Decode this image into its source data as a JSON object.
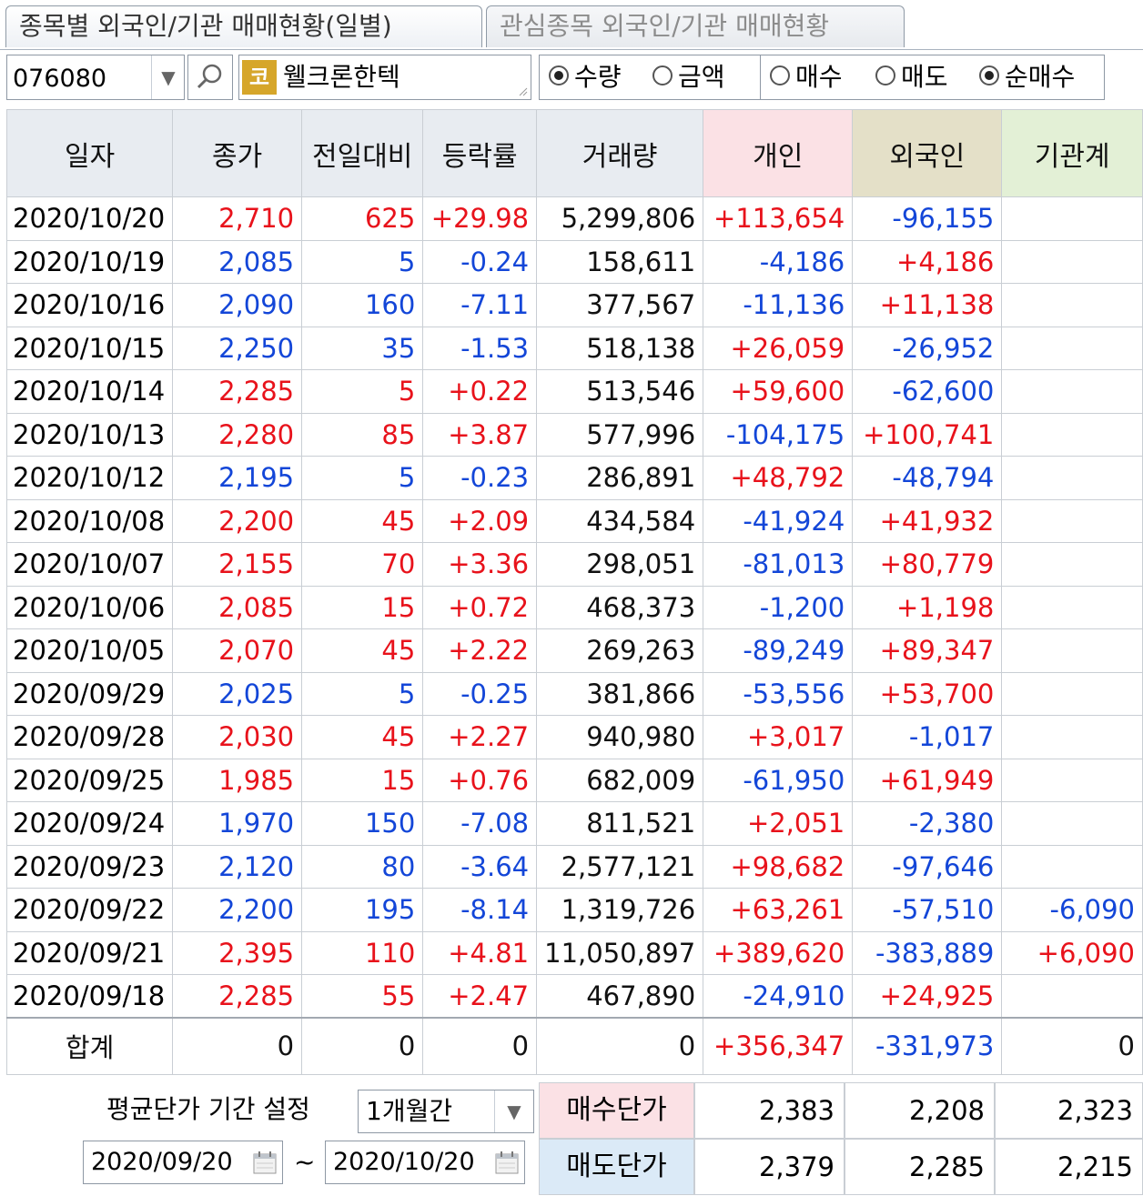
{
  "tabs": [
    {
      "label": "종목별 외국인/기관 매매현황(일별)",
      "active": true
    },
    {
      "label": "관심종목 외국인/기관 매매현황",
      "active": false
    }
  ],
  "toolbar": {
    "stock_code": "076080",
    "market_badge": "코",
    "stock_name": "웰크론한텍",
    "unit_options": [
      {
        "label": "수량",
        "selected": true
      },
      {
        "label": "금액",
        "selected": false
      }
    ],
    "type_options": [
      {
        "label": "매수",
        "selected": false
      },
      {
        "label": "매도",
        "selected": false
      },
      {
        "label": "순매수",
        "selected": true
      }
    ]
  },
  "colors": {
    "up": "#e8121b",
    "down": "#1346d8",
    "indiv_header": "#fbe1e5",
    "foreign_header": "#e4e0c8",
    "inst_header": "#e3f0d6",
    "sell_price_bg": "#dbeaf7",
    "buy_price_bg": "#fbe1e5"
  },
  "table": {
    "headers": [
      "일자",
      "종가",
      "전일대비",
      "등락률",
      "거래량",
      "개인",
      "외국인",
      "기관계"
    ],
    "rows": [
      {
        "date": "2020/10/20",
        "close": "2,710",
        "change": "625",
        "rate": "+29.98",
        "volume": "5,299,806",
        "indiv": "+113,654",
        "foreign": "-96,155",
        "inst": "",
        "dir": "up"
      },
      {
        "date": "2020/10/19",
        "close": "2,085",
        "change": "5",
        "rate": "-0.24",
        "volume": "158,611",
        "indiv": "-4,186",
        "foreign": "+4,186",
        "inst": "",
        "dir": "down"
      },
      {
        "date": "2020/10/16",
        "close": "2,090",
        "change": "160",
        "rate": "-7.11",
        "volume": "377,567",
        "indiv": "-11,136",
        "foreign": "+11,138",
        "inst": "",
        "dir": "down"
      },
      {
        "date": "2020/10/15",
        "close": "2,250",
        "change": "35",
        "rate": "-1.53",
        "volume": "518,138",
        "indiv": "+26,059",
        "foreign": "-26,952",
        "inst": "",
        "dir": "down"
      },
      {
        "date": "2020/10/14",
        "close": "2,285",
        "change": "5",
        "rate": "+0.22",
        "volume": "513,546",
        "indiv": "+59,600",
        "foreign": "-62,600",
        "inst": "",
        "dir": "up"
      },
      {
        "date": "2020/10/13",
        "close": "2,280",
        "change": "85",
        "rate": "+3.87",
        "volume": "577,996",
        "indiv": "-104,175",
        "foreign": "+100,741",
        "inst": "",
        "dir": "up"
      },
      {
        "date": "2020/10/12",
        "close": "2,195",
        "change": "5",
        "rate": "-0.23",
        "volume": "286,891",
        "indiv": "+48,792",
        "foreign": "-48,794",
        "inst": "",
        "dir": "down"
      },
      {
        "date": "2020/10/08",
        "close": "2,200",
        "change": "45",
        "rate": "+2.09",
        "volume": "434,584",
        "indiv": "-41,924",
        "foreign": "+41,932",
        "inst": "",
        "dir": "up"
      },
      {
        "date": "2020/10/07",
        "close": "2,155",
        "change": "70",
        "rate": "+3.36",
        "volume": "298,051",
        "indiv": "-81,013",
        "foreign": "+80,779",
        "inst": "",
        "dir": "up"
      },
      {
        "date": "2020/10/06",
        "close": "2,085",
        "change": "15",
        "rate": "+0.72",
        "volume": "468,373",
        "indiv": "-1,200",
        "foreign": "+1,198",
        "inst": "",
        "dir": "up"
      },
      {
        "date": "2020/10/05",
        "close": "2,070",
        "change": "45",
        "rate": "+2.22",
        "volume": "269,263",
        "indiv": "-89,249",
        "foreign": "+89,347",
        "inst": "",
        "dir": "up"
      },
      {
        "date": "2020/09/29",
        "close": "2,025",
        "change": "5",
        "rate": "-0.25",
        "volume": "381,866",
        "indiv": "-53,556",
        "foreign": "+53,700",
        "inst": "",
        "dir": "down"
      },
      {
        "date": "2020/09/28",
        "close": "2,030",
        "change": "45",
        "rate": "+2.27",
        "volume": "940,980",
        "indiv": "+3,017",
        "foreign": "-1,017",
        "inst": "",
        "dir": "up"
      },
      {
        "date": "2020/09/25",
        "close": "1,985",
        "change": "15",
        "rate": "+0.76",
        "volume": "682,009",
        "indiv": "-61,950",
        "foreign": "+61,949",
        "inst": "",
        "dir": "up"
      },
      {
        "date": "2020/09/24",
        "close": "1,970",
        "change": "150",
        "rate": "-7.08",
        "volume": "811,521",
        "indiv": "+2,051",
        "foreign": "-2,380",
        "inst": "",
        "dir": "down"
      },
      {
        "date": "2020/09/23",
        "close": "2,120",
        "change": "80",
        "rate": "-3.64",
        "volume": "2,577,121",
        "indiv": "+98,682",
        "foreign": "-97,646",
        "inst": "",
        "dir": "down"
      },
      {
        "date": "2020/09/22",
        "close": "2,200",
        "change": "195",
        "rate": "-8.14",
        "volume": "1,319,726",
        "indiv": "+63,261",
        "foreign": "-57,510",
        "inst": "-6,090",
        "dir": "down"
      },
      {
        "date": "2020/09/21",
        "close": "2,395",
        "change": "110",
        "rate": "+4.81",
        "volume": "11,050,897",
        "indiv": "+389,620",
        "foreign": "-383,889",
        "inst": "+6,090",
        "dir": "up"
      },
      {
        "date": "2020/09/18",
        "close": "2,285",
        "change": "55",
        "rate": "+2.47",
        "volume": "467,890",
        "indiv": "-24,910",
        "foreign": "+24,925",
        "inst": "",
        "dir": "up"
      }
    ],
    "total": {
      "label": "합계",
      "close": "0",
      "change": "0",
      "rate": "0",
      "volume": "0",
      "indiv": "+356,347",
      "foreign": "-331,973",
      "inst": "0"
    }
  },
  "avg_price": {
    "label": "평균단가 기간 설정",
    "period": "1개월간",
    "from_date": "2020/09/20",
    "tilde": "~",
    "to_date": "2020/10/20",
    "buy_label": "매수단가",
    "sell_label": "매도단가",
    "buy": {
      "indiv": "2,383",
      "foreign": "2,208",
      "inst": "2,323"
    },
    "sell": {
      "indiv": "2,379",
      "foreign": "2,285",
      "inst": "2,215"
    }
  }
}
